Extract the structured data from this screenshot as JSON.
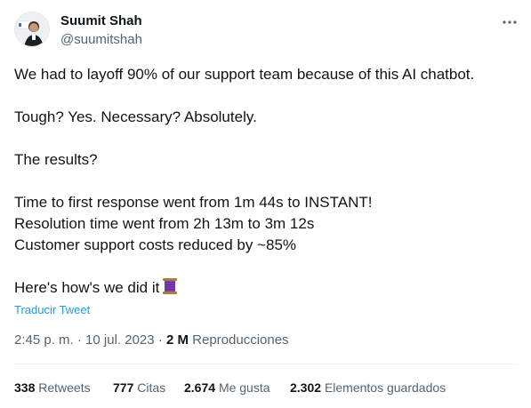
{
  "author": {
    "name": "Suumit Shah",
    "handle": "@suumitshah"
  },
  "body": {
    "line1": "We had to layoff 90% of our support team because of this AI chatbot.",
    "line2": "Tough? Yes. Necessary? Absolutely.",
    "line3": "The results?",
    "line4": "Time to first response went from 1m 44s to INSTANT!",
    "line5": "Resolution time went from 2h 13m to 3m 12s",
    "line6": "Customer support costs reduced by ~85%",
    "line7": "Here's how's we did it"
  },
  "translate_label": "Traducir Tweet",
  "meta": {
    "time": "2:45 p. m.",
    "separator": "·",
    "date": "10 jul. 2023",
    "views_count": "2 M",
    "views_label": "Reproducciones"
  },
  "stats": {
    "retweets_count": "338",
    "retweets_label": "Retweets",
    "quotes_count": "777",
    "quotes_label": "Citas",
    "likes_count": "2.674",
    "likes_label": "Me gusta",
    "bookmarks_count": "2.302",
    "bookmarks_label": "Elementos guardados"
  },
  "colors": {
    "text": "#0f1419",
    "secondary": "#536471",
    "link": "#1d9bf0",
    "divider": "#eff3f4"
  },
  "icons": {
    "more": "more-horizontal-icon",
    "thread": "thread-spool-emoji"
  }
}
